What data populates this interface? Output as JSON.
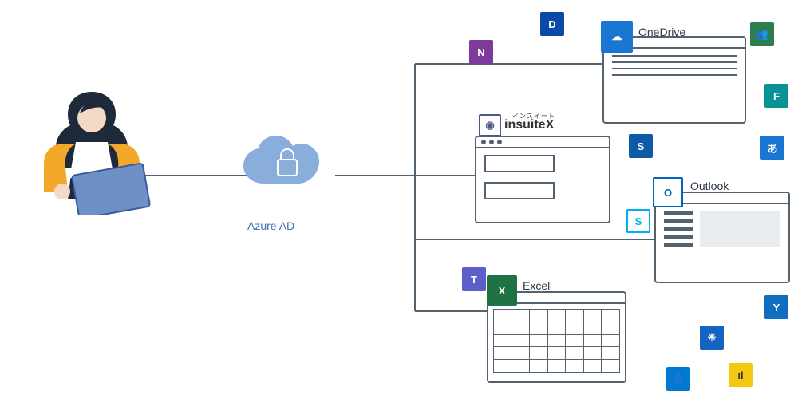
{
  "labels": {
    "azure": "Azure AD",
    "onedrive": "OneDrive",
    "insuitex": "insuiteX",
    "insuitex_sub": "インスイート",
    "outlook": "Outlook",
    "excel": "Excel"
  },
  "icons": {
    "dynamics": {
      "bg": "#0b4aa8",
      "glyph": "D"
    },
    "onenote": {
      "bg": "#7d3a9a",
      "glyph": "N"
    },
    "onedrive": {
      "bg": "#1976d2",
      "glyph": "☁"
    },
    "people": {
      "bg": "#2e7d4f",
      "glyph": "👥"
    },
    "forms": {
      "bg": "#0a9396",
      "glyph": "F"
    },
    "sharepoint": {
      "bg": "#0e5aa7",
      "glyph": "S"
    },
    "translator": {
      "bg": "#1976d2",
      "glyph": "あ"
    },
    "skype": {
      "bg": "#fff",
      "glyph": "S",
      "fg": "#00aff0",
      "border": "#00aff0"
    },
    "teams": {
      "bg": "#5b5fc7",
      "glyph": "T"
    },
    "excel": {
      "bg": "#1f7244",
      "glyph": "X"
    },
    "outlook": {
      "bg": "#fff",
      "glyph": "O",
      "fg": "#0364b8",
      "border": "#0364b8"
    },
    "yammer": {
      "bg": "#106ebe",
      "glyph": "Y"
    },
    "weather": {
      "bg": "#1565c0",
      "glyph": "☀"
    },
    "delve": {
      "bg": "#0078d4",
      "glyph": "👤"
    },
    "powerbi": {
      "bg": "#f2c811",
      "glyph": "ıl",
      "fg": "#333"
    },
    "insuitex": {
      "bg": "#fff",
      "glyph": "◉",
      "fg": "#4a5a8a",
      "border": "#4a5a8a"
    }
  }
}
